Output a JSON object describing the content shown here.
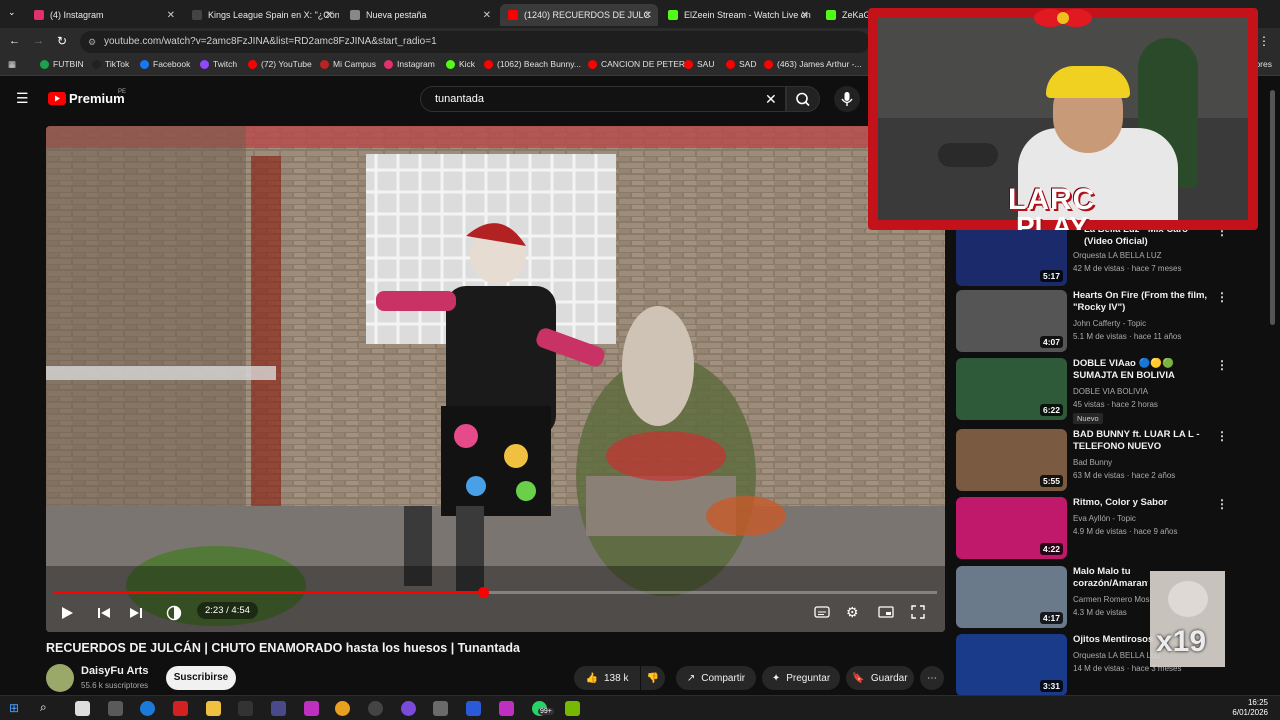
{
  "browser": {
    "tabs": [
      {
        "label": "(4) Instagram",
        "color": "#e1306c"
      },
      {
        "label": "Kings League Spain en X: \"¿Cón",
        "color": "#000000"
      },
      {
        "label": "Nueva pestaña",
        "color": "#888888"
      },
      {
        "label": "(1240) RECUERDOS DE JULC",
        "color": "#ff0000"
      },
      {
        "label": "ElZeein Stream - Watch Live on",
        "color": "#53fc18"
      },
      {
        "label": "ZeKaGar",
        "color": "#53fc18"
      }
    ],
    "url": "youtube.com/watch?v=2amc8FzJINA&list=RD2amc8FzJINA&start_radio=1",
    "bookmarks": [
      "FUTBIN",
      "TikTok",
      "Facebook",
      "Twitch",
      "(72) YouTube",
      "Mi Campus",
      "Instagram",
      "Kick",
      "(1062) Beach Bunny...",
      "CANCION DE PETER",
      "SAU",
      "SAD",
      "(463) James Arthur -..."
    ],
    "bookmarks_right": "adores"
  },
  "header": {
    "logo_text": "Premium",
    "region": "PE",
    "search_value": "tunantada"
  },
  "player": {
    "time": "2:23 / 4:54",
    "progress": 0.486
  },
  "video": {
    "title": "RECUERDOS DE JULCÁN | CHUTO ENAMORADO hasta los huesos | Tunantada",
    "channel": "DaisyFu Arts",
    "subscribers": "55.6 k suscriptores",
    "subscribe_label": "Suscribirse",
    "likes": "138 k",
    "share_label": "Compartir",
    "ask_label": "Preguntar",
    "save_label": "Guardar"
  },
  "sidebar": [
    {
      "title": "La Bella Luz - Mix Caro (Video Oficial)",
      "channel": "Orquesta LA BELLA LUZ",
      "meta": "42 M de vistas · hace 7 meses",
      "duration": "5:17",
      "thumb": "#1a2a6a"
    },
    {
      "title": "Hearts On Fire (From the film, \"Rocky IV\")",
      "channel": "John Cafferty - Topic",
      "meta": "5.1 M de vistas · hace 11 años",
      "duration": "4:07",
      "thumb": "#555555"
    },
    {
      "title": "DOBLE VIAao 🔵🟡🟢 SUMAJTA EN BOLIVIA NÉCTA...",
      "channel": "DOBLE VIA BOLIVIA",
      "meta": "45 vistas · hace 2 horas",
      "duration": "6:22",
      "thumb": "#2e5a3a",
      "badge": "Nuevo"
    },
    {
      "title": "BAD BUNNY ft. LUAR LA L - TELEFONO NUEVO (Visualizer...",
      "channel": "Bad Bunny",
      "meta": "63 M de vistas · hace 2 años",
      "duration": "5:55",
      "thumb": "#7a5a40"
    },
    {
      "title": "Ritmo, Color y Sabor",
      "channel": "Eva Ayllón - Topic",
      "meta": "4.9 M de vistas · hace 9 años",
      "duration": "4:22",
      "thumb": "#c0186a"
    },
    {
      "title": "Malo Malo tu corazón/Amarante",
      "channel": "Carmen Romero Mos",
      "meta": "4.3 M de vistas",
      "duration": "4:17",
      "thumb": "#6a7a8a"
    },
    {
      "title": "Ojitos Mentirosos",
      "channel": "Orquesta LA BELLA LUZ",
      "meta": "14 M de vistas · hace 3 meses",
      "duration": "3:31",
      "thumb": "#1a3a8a"
    }
  ],
  "overlay": {
    "brand_line1": "LARC",
    "brand_line2": "PLAY",
    "multiplier": "x19"
  },
  "taskbar": {
    "time": "16:25",
    "date": "6/01/2026",
    "badge": "99+"
  }
}
